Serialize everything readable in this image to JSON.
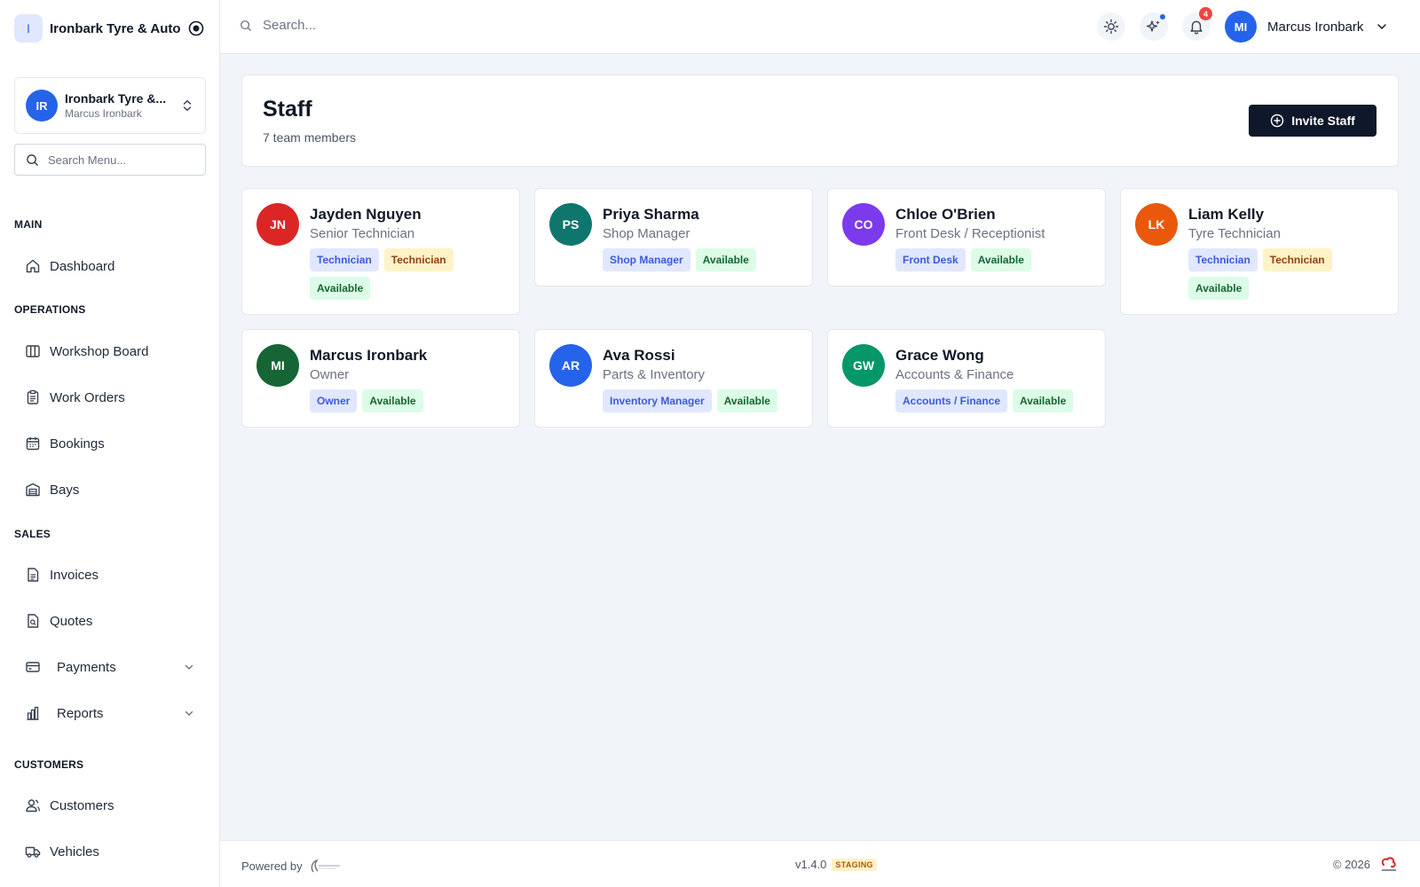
{
  "app": {
    "brand_initial": "I",
    "brand_name": "Ironbark Tyre & Auto"
  },
  "org_switcher": {
    "initials": "IR",
    "name": "Ironbark Tyre &...",
    "user": "Marcus Ironbark"
  },
  "sidebar": {
    "search_placeholder": "Search Menu...",
    "sections": {
      "main": "MAIN",
      "operations": "OPERATIONS",
      "sales": "SALES",
      "customers": "CUSTOMERS"
    },
    "items": {
      "dashboard": "Dashboard",
      "workshop_board": "Workshop Board",
      "work_orders": "Work Orders",
      "bookings": "Bookings",
      "bays": "Bays",
      "invoices": "Invoices",
      "quotes": "Quotes",
      "payments": "Payments",
      "reports": "Reports",
      "customers": "Customers",
      "vehicles": "Vehicles"
    }
  },
  "topbar": {
    "search_placeholder": "Search...",
    "notification_count": "4",
    "user_initials": "MI",
    "user_name": "Marcus Ironbark"
  },
  "page": {
    "title": "Staff",
    "subtitle": "7 team members",
    "invite_button": "Invite Staff"
  },
  "staff": [
    {
      "initials": "JN",
      "name": "Jayden Nguyen",
      "role": "Senior Technician",
      "avatar_color": "#dc2626",
      "tags": [
        {
          "label": "Technician",
          "kind": "role"
        },
        {
          "label": "Technician",
          "kind": "skill"
        },
        {
          "label": "Available",
          "kind": "status"
        }
      ]
    },
    {
      "initials": "PS",
      "name": "Priya Sharma",
      "role": "Shop Manager",
      "avatar_color": "#0f766e",
      "tags": [
        {
          "label": "Shop Manager",
          "kind": "role"
        },
        {
          "label": "Available",
          "kind": "status"
        }
      ]
    },
    {
      "initials": "CO",
      "name": "Chloe O'Brien",
      "role": "Front Desk / Receptionist",
      "avatar_color": "#7c3aed",
      "tags": [
        {
          "label": "Front Desk",
          "kind": "role"
        },
        {
          "label": "Available",
          "kind": "status"
        }
      ]
    },
    {
      "initials": "LK",
      "name": "Liam Kelly",
      "role": "Tyre Technician",
      "avatar_color": "#ea580c",
      "tags": [
        {
          "label": "Technician",
          "kind": "role"
        },
        {
          "label": "Technician",
          "kind": "skill"
        },
        {
          "label": "Available",
          "kind": "status"
        }
      ]
    },
    {
      "initials": "MI",
      "name": "Marcus Ironbark",
      "role": "Owner",
      "avatar_color": "#166534",
      "tags": [
        {
          "label": "Owner",
          "kind": "role"
        },
        {
          "label": "Available",
          "kind": "status"
        }
      ]
    },
    {
      "initials": "AR",
      "name": "Ava Rossi",
      "role": "Parts & Inventory",
      "avatar_color": "#2563eb",
      "tags": [
        {
          "label": "Inventory Manager",
          "kind": "role"
        },
        {
          "label": "Available",
          "kind": "status"
        }
      ]
    },
    {
      "initials": "GW",
      "name": "Grace Wong",
      "role": "Accounts & Finance",
      "avatar_color": "#059669",
      "tags": [
        {
          "label": "Accounts / Finance",
          "kind": "role"
        },
        {
          "label": "Available",
          "kind": "status"
        }
      ]
    }
  ],
  "tag_styles": {
    "role": {
      "bg": "#e0e7ff",
      "fg": "#3b5bdb"
    },
    "skill": {
      "bg": "#fef3c7",
      "fg": "#92400e"
    },
    "status": {
      "bg": "#dcfce7",
      "fg": "#166534"
    }
  },
  "footer": {
    "powered_by": "Powered by",
    "version": "v1.4.0",
    "environment": "STAGING",
    "copyright": "© 2026"
  },
  "colors": {
    "accent": "#2563eb",
    "primary_button": "#0f172a",
    "background": "#f1f4f8"
  }
}
